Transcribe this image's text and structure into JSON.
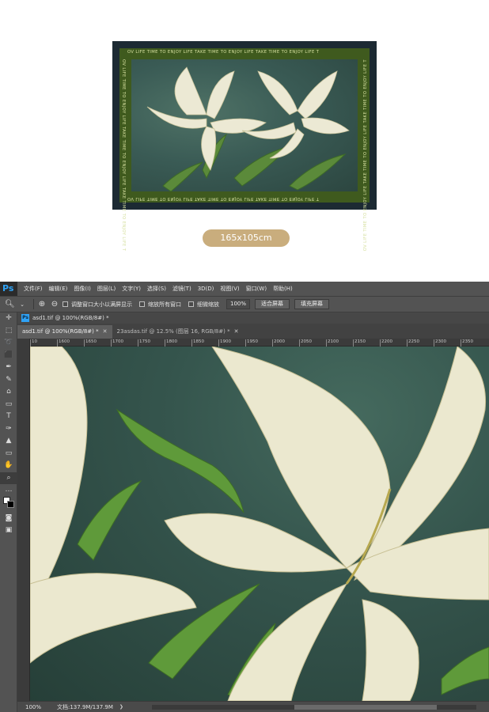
{
  "preview": {
    "border_text": "OV LIFE TIME TO ENJOY LIFE TAKE TIME TO ENJOY LIFE TAKE TIME TO ENJOY LIFE T",
    "size_label": "165x105cm"
  },
  "ps": {
    "logo": "Ps",
    "menu": [
      "文件(F)",
      "编辑(E)",
      "图像(I)",
      "图层(L)",
      "文字(Y)",
      "选择(S)",
      "滤镜(T)",
      "3D(D)",
      "视图(V)",
      "窗口(W)",
      "帮助(H)"
    ],
    "options": {
      "checks": [
        "调整窗口大小以满屏显示",
        "缩放所有窗口",
        "细微缩放"
      ],
      "zoom_value": "100%",
      "buttons": [
        "适合屏幕",
        "填充屏幕"
      ]
    },
    "doc_header_title": "asd1.tif @ 100%(RGB/8#) *",
    "tabs": [
      {
        "label": "asd1.tif @ 100%(RGB/8#) *",
        "active": true
      },
      {
        "label": "23asdas.tif @ 12.5% (图层 16, RGB/8#) *",
        "active": false
      }
    ],
    "ruler_ticks": [
      "10",
      "1600",
      "1650",
      "1700",
      "1750",
      "1800",
      "1850",
      "1900",
      "1950",
      "2000",
      "2050",
      "2100",
      "2150",
      "2200",
      "2250",
      "2300",
      "2350"
    ],
    "status": {
      "zoom": "100%",
      "doc_info": "文档:137.9M/137.9M"
    },
    "colors": {
      "ps_blue": "#2fa3f6",
      "panel": "#535353",
      "dark": "#3b3b3b"
    }
  }
}
